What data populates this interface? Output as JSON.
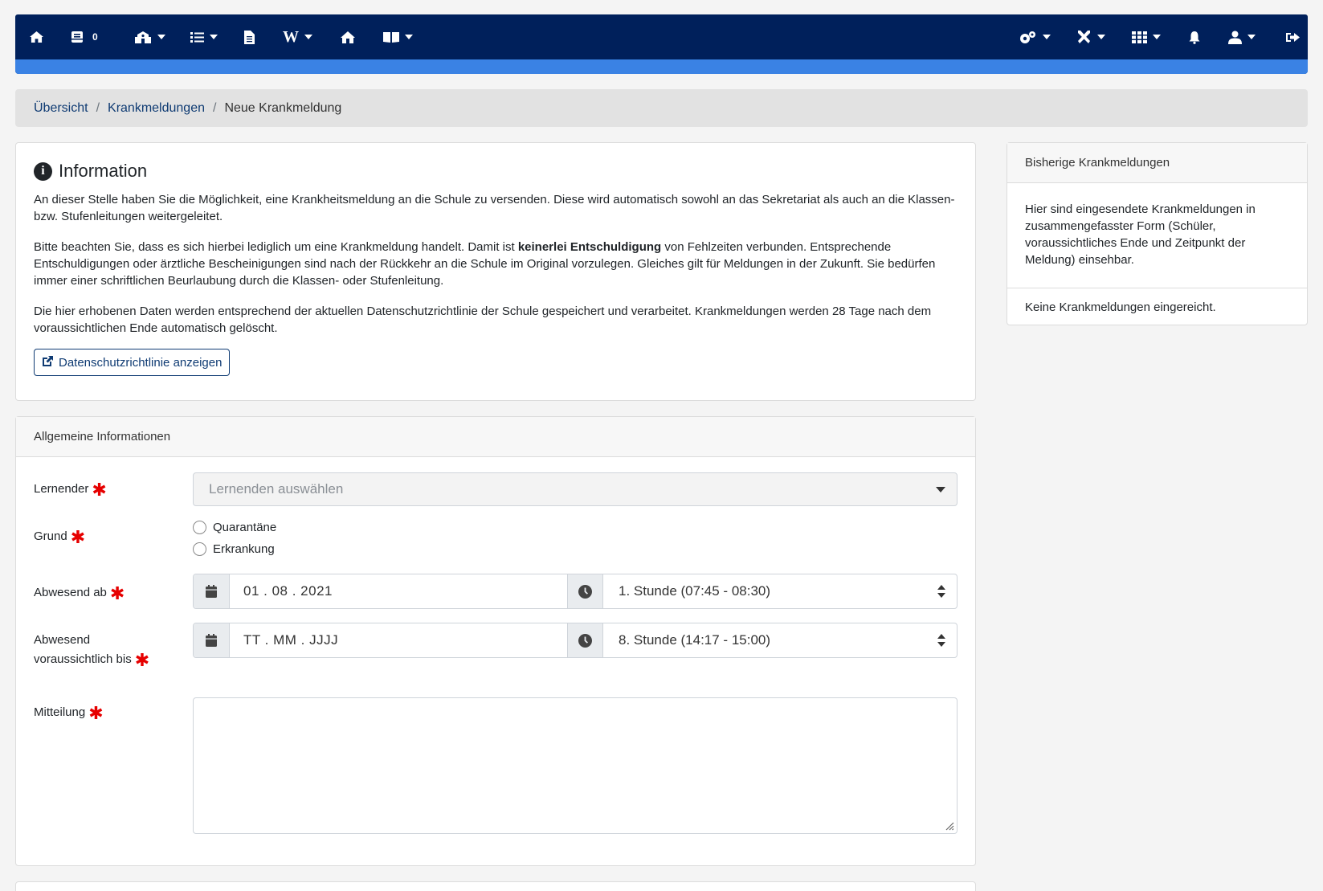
{
  "nav": {
    "message_count": "0",
    "wiki_label": "W",
    "icons_left": [
      "home-icon",
      "inbox-icon",
      "school-icon",
      "list-icon",
      "document-icon",
      "wikipedia-icon",
      "house-icon",
      "book-icon"
    ],
    "icons_right": [
      "cogs-icon",
      "tools-icon",
      "grid-icon",
      "bell-icon",
      "user-icon",
      "logout-icon"
    ],
    "accent_color": "#3a82e4",
    "bar_color": "#00205b"
  },
  "breadcrumb": {
    "items": [
      "Übersicht",
      "Krankmeldungen"
    ],
    "separator": "/",
    "current": "Neue Krankmeldung"
  },
  "info": {
    "title": "Information",
    "p1": "An dieser Stelle haben Sie die Möglichkeit, eine Krankheitsmeldung an die Schule zu versenden. Diese wird automatisch sowohl an das Sekretariat als auch an die Klassen- bzw. Stufenleitungen weitergeleitet.",
    "p2_before": "Bitte beachten Sie, dass es sich hierbei lediglich um eine Krankmeldung handelt. Damit ist ",
    "p2_bold": "keinerlei Entschuldigung",
    "p2_after": " von Fehlzeiten verbunden. Entsprechende Entschuldigungen oder ärztliche Bescheinigungen sind nach der Rückkehr an die Schule im Original vorzulegen. Gleiches gilt für Meldungen in der Zukunft. Sie bedürfen immer einer schriftlichen Beurlaubung durch die Klassen- oder Stufenleitung.",
    "p3": "Die hier erhobenen Daten werden entsprechend der aktuellen Datenschutzrichtlinie der Schule gespeichert und verarbeitet. Krankmeldungen werden 28 Tage nach dem voraussichtlichen Ende automatisch gelöscht.",
    "privacy_button": "Datenschutzrichtlinie anzeigen"
  },
  "side": {
    "title": "Bisherige Krankmeldungen",
    "description": "Hier sind eingesendete Krankmeldungen in zusammengefasster Form (Schüler, voraussichtliches Ende und Zeitpunkt der Meldung) einsehbar.",
    "empty": "Keine Krankmeldungen eingereicht."
  },
  "form": {
    "header": "Allgemeine Informationen",
    "required_mark": "✱",
    "learner_label": "Lernender",
    "learner_placeholder": "Lernenden auswählen",
    "reason_label": "Grund",
    "reason_options": [
      "Quarantäne",
      "Erkrankung"
    ],
    "absent_from_label": "Abwesend ab",
    "absent_from_date": "01 . 08 . 2021",
    "absent_from_period": "1. Stunde (07:45 - 08:30)",
    "absent_until_label_1": "Abwesend",
    "absent_until_label_2": "voraussichtlich bis",
    "absent_until_date": "TT . MM . JJJJ",
    "absent_until_period": "8. Stunde (14:17 - 15:00)",
    "message_label": "Mitteilung",
    "message_value": ""
  }
}
